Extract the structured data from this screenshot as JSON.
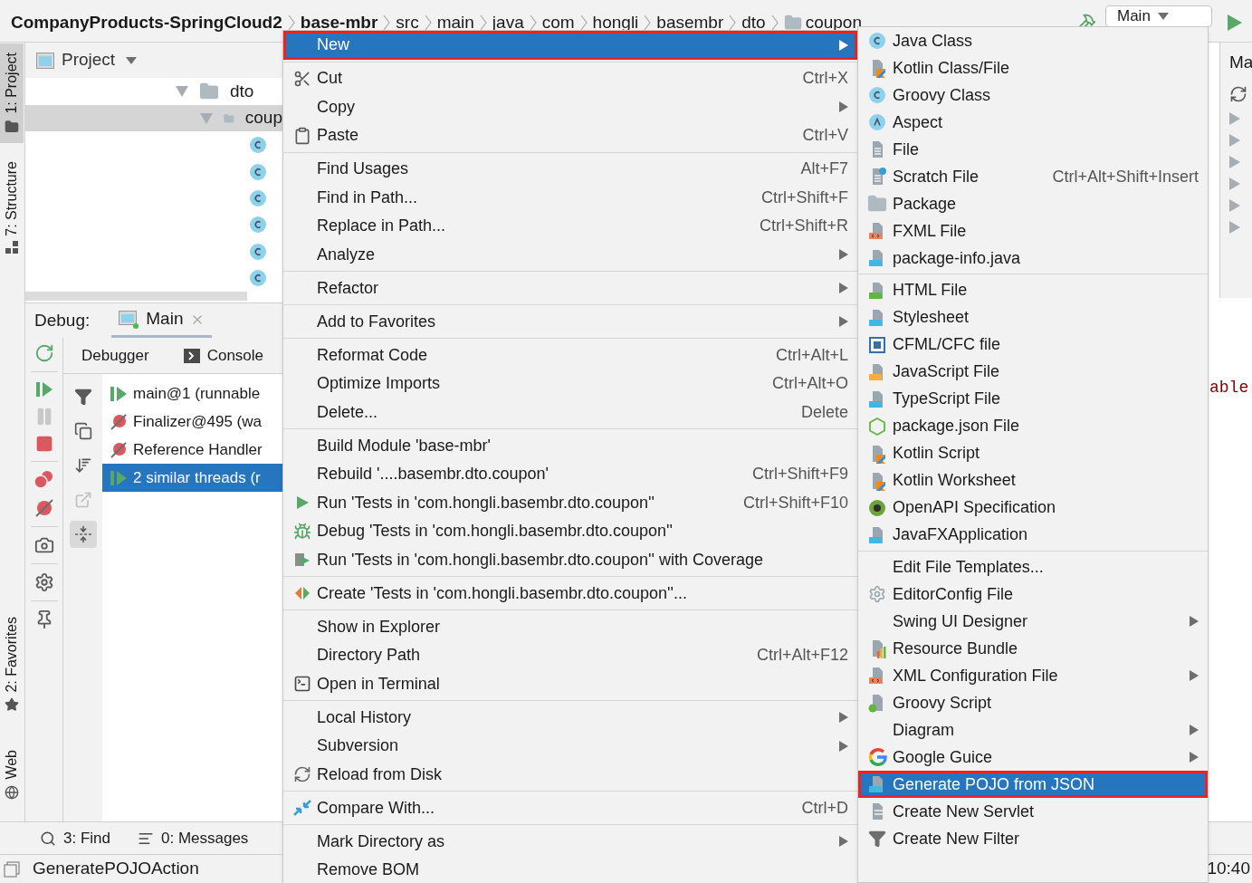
{
  "breadcrumbs": [
    {
      "label": "CompanyProducts-SpringCloud2",
      "kind": "project"
    },
    {
      "label": "base-mbr",
      "kind": "module"
    },
    {
      "label": "src",
      "kind": "directory"
    },
    {
      "label": "main",
      "kind": "directory"
    },
    {
      "label": "java",
      "kind": "directory"
    },
    {
      "label": "com",
      "kind": "directory"
    },
    {
      "label": "hongli",
      "kind": "directory"
    },
    {
      "label": "basembr",
      "kind": "directory"
    },
    {
      "label": "dto",
      "kind": "directory"
    },
    {
      "label": "coupon",
      "kind": "package"
    }
  ],
  "run_config": {
    "label": "Main"
  },
  "side_tabs_top": [
    {
      "label": "1: Project",
      "selected": true
    },
    {
      "label": "7: Structure",
      "selected": false
    }
  ],
  "side_tabs_bottom": [
    {
      "label": "2: Favorites",
      "selected": false
    },
    {
      "label": "Web",
      "selected": false
    }
  ],
  "project_panel": {
    "title": "Project",
    "tree": [
      {
        "label": "dto",
        "expanded": true,
        "selected": false,
        "children": [
          {
            "label": "coup",
            "expanded": true,
            "selected": true,
            "children": [
              {
                "kind": "class"
              },
              {
                "kind": "class"
              },
              {
                "kind": "class"
              },
              {
                "kind": "class"
              },
              {
                "kind": "class"
              },
              {
                "kind": "class"
              }
            ]
          }
        ]
      }
    ]
  },
  "debug_panel": {
    "label": "Debug:",
    "tab": {
      "label": "Main"
    },
    "subtabs": [
      {
        "label": "Debugger"
      },
      {
        "label": "Console"
      }
    ],
    "threads": [
      {
        "label": "main@1 (runnable",
        "kind": "running",
        "selected": false
      },
      {
        "label": "Finalizer@495 (wa",
        "kind": "waiting",
        "selected": false
      },
      {
        "label": "Reference Handler",
        "kind": "waiting",
        "selected": false
      },
      {
        "label": "2 similar threads (r",
        "kind": "running",
        "selected": true
      }
    ]
  },
  "bottom_tools": [
    {
      "label": "3: Find"
    },
    {
      "label": "0: Messages"
    }
  ],
  "status_bar": {
    "text": "GeneratePOJOAction",
    "time": "10:40"
  },
  "right_panel": {
    "title": "Ma",
    "code_fragment": "able"
  },
  "context_menu": {
    "groups": [
      [
        {
          "label": "New",
          "selected": true,
          "submenu": true,
          "highlighted": true
        }
      ],
      [
        {
          "label": "Cut",
          "kind": "scissors",
          "shortcut": "Ctrl+X",
          "selected": false,
          "submenu": false,
          "highlighted": false
        },
        {
          "label": "Copy",
          "selected": false,
          "submenu": true,
          "highlighted": false
        },
        {
          "label": "Paste",
          "kind": "clipboard",
          "shortcut": "Ctrl+V",
          "selected": false,
          "submenu": false,
          "highlighted": false
        }
      ],
      [
        {
          "label": "Find Usages",
          "shortcut": "Alt+F7",
          "selected": false,
          "submenu": false,
          "highlighted": false
        },
        {
          "label": "Find in Path...",
          "shortcut": "Ctrl+Shift+F",
          "selected": false,
          "submenu": false,
          "highlighted": false
        },
        {
          "label": "Replace in Path...",
          "shortcut": "Ctrl+Shift+R",
          "selected": false,
          "submenu": false,
          "highlighted": false
        },
        {
          "label": "Analyze",
          "selected": false,
          "submenu": true,
          "highlighted": false
        }
      ],
      [
        {
          "label": "Refactor",
          "selected": false,
          "submenu": true,
          "highlighted": false
        }
      ],
      [
        {
          "label": "Add to Favorites",
          "selected": false,
          "submenu": true,
          "highlighted": false
        }
      ],
      [
        {
          "label": "Reformat Code",
          "shortcut": "Ctrl+Alt+L",
          "selected": false,
          "submenu": false,
          "highlighted": false
        },
        {
          "label": "Optimize Imports",
          "shortcut": "Ctrl+Alt+O",
          "selected": false,
          "submenu": false,
          "highlighted": false
        },
        {
          "label": "Delete...",
          "shortcut": "Delete",
          "selected": false,
          "submenu": false,
          "highlighted": false
        }
      ],
      [
        {
          "label": "Build Module 'base-mbr'",
          "selected": false,
          "submenu": false,
          "highlighted": false
        },
        {
          "label": "Rebuild '....basembr.dto.coupon'",
          "shortcut": "Ctrl+Shift+F9",
          "selected": false,
          "submenu": false,
          "highlighted": false
        },
        {
          "label": "Run 'Tests in 'com.hongli.basembr.dto.coupon''",
          "kind": "run",
          "shortcut": "Ctrl+Shift+F10",
          "selected": false,
          "submenu": false,
          "highlighted": false
        },
        {
          "label": "Debug 'Tests in 'com.hongli.basembr.dto.coupon''",
          "kind": "debug",
          "selected": false,
          "submenu": false,
          "highlighted": false
        },
        {
          "label": "Run 'Tests in 'com.hongli.basembr.dto.coupon'' with Coverage",
          "kind": "coverage",
          "selected": false,
          "submenu": false,
          "highlighted": false
        }
      ],
      [
        {
          "label": "Create 'Tests in 'com.hongli.basembr.dto.coupon''...",
          "kind": "create-test",
          "selected": false,
          "submenu": false,
          "highlighted": false
        }
      ],
      [
        {
          "label": "Show in Explorer",
          "selected": false,
          "submenu": false,
          "highlighted": false
        },
        {
          "label": "Directory Path",
          "shortcut": "Ctrl+Alt+F12",
          "selected": false,
          "submenu": false,
          "highlighted": false
        },
        {
          "label": "Open in Terminal",
          "kind": "terminal",
          "selected": false,
          "submenu": false,
          "highlighted": false
        }
      ],
      [
        {
          "label": "Local History",
          "selected": false,
          "submenu": true,
          "highlighted": false
        },
        {
          "label": "Subversion",
          "selected": false,
          "submenu": true,
          "highlighted": false
        },
        {
          "label": "Reload from Disk",
          "kind": "reload",
          "selected": false,
          "submenu": false,
          "highlighted": false
        }
      ],
      [
        {
          "label": "Compare With...",
          "kind": "compare",
          "shortcut": "Ctrl+D",
          "selected": false,
          "submenu": false,
          "highlighted": false
        }
      ],
      [
        {
          "label": "Mark Directory as",
          "selected": false,
          "submenu": true,
          "highlighted": false
        },
        {
          "label": "Remove BOM",
          "selected": false,
          "submenu": false,
          "highlighted": false
        }
      ]
    ]
  },
  "submenu": {
    "groups": [
      [
        {
          "label": "Java Class",
          "kind": "class",
          "selected": false,
          "submenu": false,
          "highlighted": false
        },
        {
          "label": "Kotlin Class/File",
          "kind": "kotlin",
          "selected": false,
          "submenu": false,
          "highlighted": false
        },
        {
          "label": "Groovy Class",
          "kind": "class",
          "selected": false,
          "submenu": false,
          "highlighted": false
        },
        {
          "label": "Aspect",
          "kind": "aspect",
          "selected": false,
          "submenu": false,
          "highlighted": false
        },
        {
          "label": "File",
          "kind": "file",
          "selected": false,
          "submenu": false,
          "highlighted": false
        },
        {
          "label": "Scratch File",
          "kind": "scratch",
          "shortcut": "Ctrl+Alt+Shift+Insert",
          "selected": false,
          "submenu": false,
          "highlighted": false
        },
        {
          "label": "Package",
          "kind": "folder",
          "selected": false,
          "submenu": false,
          "highlighted": false
        },
        {
          "label": "FXML File",
          "kind": "markup",
          "selected": false,
          "submenu": false,
          "highlighted": false
        },
        {
          "label": "package-info.java",
          "kind": "java",
          "selected": false,
          "submenu": false,
          "highlighted": false
        }
      ],
      [
        {
          "label": "HTML File",
          "kind": "html",
          "selected": false,
          "submenu": false,
          "highlighted": false
        },
        {
          "label": "Stylesheet",
          "kind": "java",
          "selected": false,
          "submenu": false,
          "highlighted": false
        },
        {
          "label": "CFML/CFC file",
          "kind": "cfml",
          "selected": false,
          "submenu": false,
          "highlighted": false
        },
        {
          "label": "JavaScript File",
          "kind": "script",
          "selected": false,
          "submenu": false,
          "highlighted": false
        },
        {
          "label": "TypeScript File",
          "kind": "java",
          "selected": false,
          "submenu": false,
          "highlighted": false
        },
        {
          "label": "package.json File",
          "kind": "hexagon",
          "selected": false,
          "submenu": false,
          "highlighted": false
        },
        {
          "label": "Kotlin Script",
          "kind": "kotlin",
          "selected": false,
          "submenu": false,
          "highlighted": false
        },
        {
          "label": "Kotlin Worksheet",
          "kind": "kotlin",
          "selected": false,
          "submenu": false,
          "highlighted": false
        },
        {
          "label": "OpenAPI Specification",
          "kind": "openapi",
          "selected": false,
          "submenu": false,
          "highlighted": false
        },
        {
          "label": "JavaFXApplication",
          "kind": "java",
          "selected": false,
          "submenu": false,
          "highlighted": false
        }
      ],
      [
        {
          "label": "Edit File Templates...",
          "selected": false,
          "submenu": false,
          "highlighted": false
        },
        {
          "label": "EditorConfig File",
          "kind": "gear",
          "selected": false,
          "submenu": false,
          "highlighted": false
        },
        {
          "label": "Swing UI Designer",
          "selected": false,
          "submenu": true,
          "highlighted": false
        },
        {
          "label": "Resource Bundle",
          "kind": "bundle",
          "selected": false,
          "submenu": false,
          "highlighted": false
        },
        {
          "label": "XML Configuration File",
          "kind": "markup",
          "selected": false,
          "submenu": true,
          "highlighted": false
        },
        {
          "label": "Groovy Script",
          "kind": "groovy-script",
          "selected": false,
          "submenu": false,
          "highlighted": false
        },
        {
          "label": "Diagram",
          "selected": false,
          "submenu": true,
          "highlighted": false
        },
        {
          "label": "Google Guice",
          "kind": "google",
          "selected": false,
          "submenu": true,
          "highlighted": false
        },
        {
          "label": "Generate POJO from JSON",
          "kind": "java",
          "selected": true,
          "submenu": false,
          "highlighted": true
        },
        {
          "label": "Create New Servlet",
          "kind": "servlet",
          "selected": false,
          "submenu": false,
          "highlighted": false
        },
        {
          "label": "Create New Filter",
          "kind": "filter",
          "selected": false,
          "submenu": false,
          "highlighted": false
        }
      ]
    ]
  }
}
